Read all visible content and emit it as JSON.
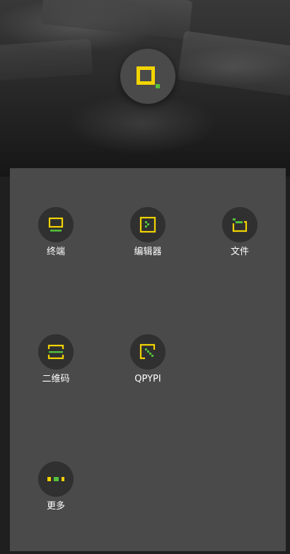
{
  "apps": {
    "terminal": {
      "label": "终端",
      "icon": "terminal-icon"
    },
    "editor": {
      "label": "编辑器",
      "icon": "editor-icon"
    },
    "files": {
      "label": "文件",
      "icon": "folder-icon"
    },
    "qrcode": {
      "label": "二维码",
      "icon": "qr-scan-icon"
    },
    "qpypi": {
      "label": "QPYPI",
      "icon": "package-icon"
    },
    "more": {
      "label": "更多",
      "icon": "more-dots-icon"
    }
  },
  "colors": {
    "accent_yellow": "#f2d400",
    "accent_green": "#53c23c",
    "panel": "#4a4a4a",
    "icon_bg": "#303030"
  }
}
